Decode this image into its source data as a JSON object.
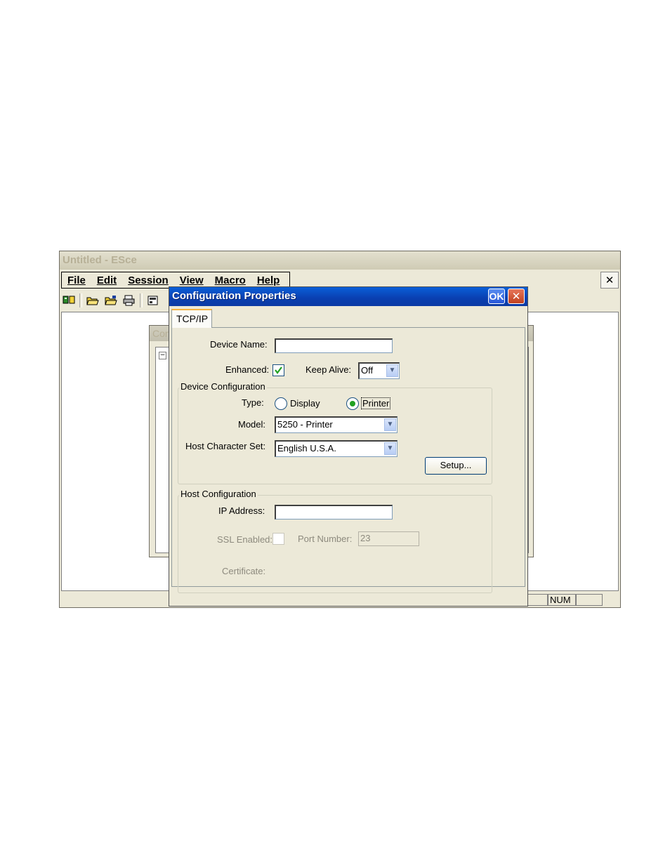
{
  "app": {
    "title": "Untitled - ESce",
    "menu": [
      "File",
      "Edit",
      "Session",
      "View",
      "Macro",
      "Help"
    ],
    "close_glyph": "✕",
    "toolbar_icons": [
      "connect-icon",
      "open-folder-icon",
      "open-folder-alt-icon",
      "print-icon",
      "printer-setup-icon"
    ],
    "inner_window_title": "Con",
    "tree_expand_glyph": "⊟",
    "status_num": "NUM"
  },
  "dialog": {
    "title": "Configuration Properties",
    "ok_label": "OK",
    "close_glyph": "✕",
    "tab_label": "TCP/IP",
    "device_name_label": "Device Name:",
    "device_name_value": "",
    "enhanced_label": "Enhanced:",
    "enhanced_checked": true,
    "keep_alive_label": "Keep Alive:",
    "keep_alive_value": "Off",
    "device_config_title": "Device Configuration",
    "type_label": "Type:",
    "type_options": [
      "Display",
      "Printer"
    ],
    "type_selected": "Printer",
    "model_label": "Model:",
    "model_value": "5250 - Printer",
    "setup_button_label": "Setup...",
    "host_charset_label": "Host Character Set:",
    "host_charset_value": "English U.S.A.",
    "host_config_title": "Host Configuration",
    "ip_address_label": "IP Address:",
    "ip_address_value": "",
    "ssl_enabled_label": "SSL Enabled:",
    "ssl_enabled_checked": false,
    "port_number_label": "Port Number:",
    "port_number_value": "23",
    "certificate_label": "Certificate:"
  },
  "colors": {
    "dialog_titlebar": "#0a4fc8",
    "window_face": "#ece9d8",
    "check_green": "#21a121",
    "close_red": "#c0401f"
  }
}
